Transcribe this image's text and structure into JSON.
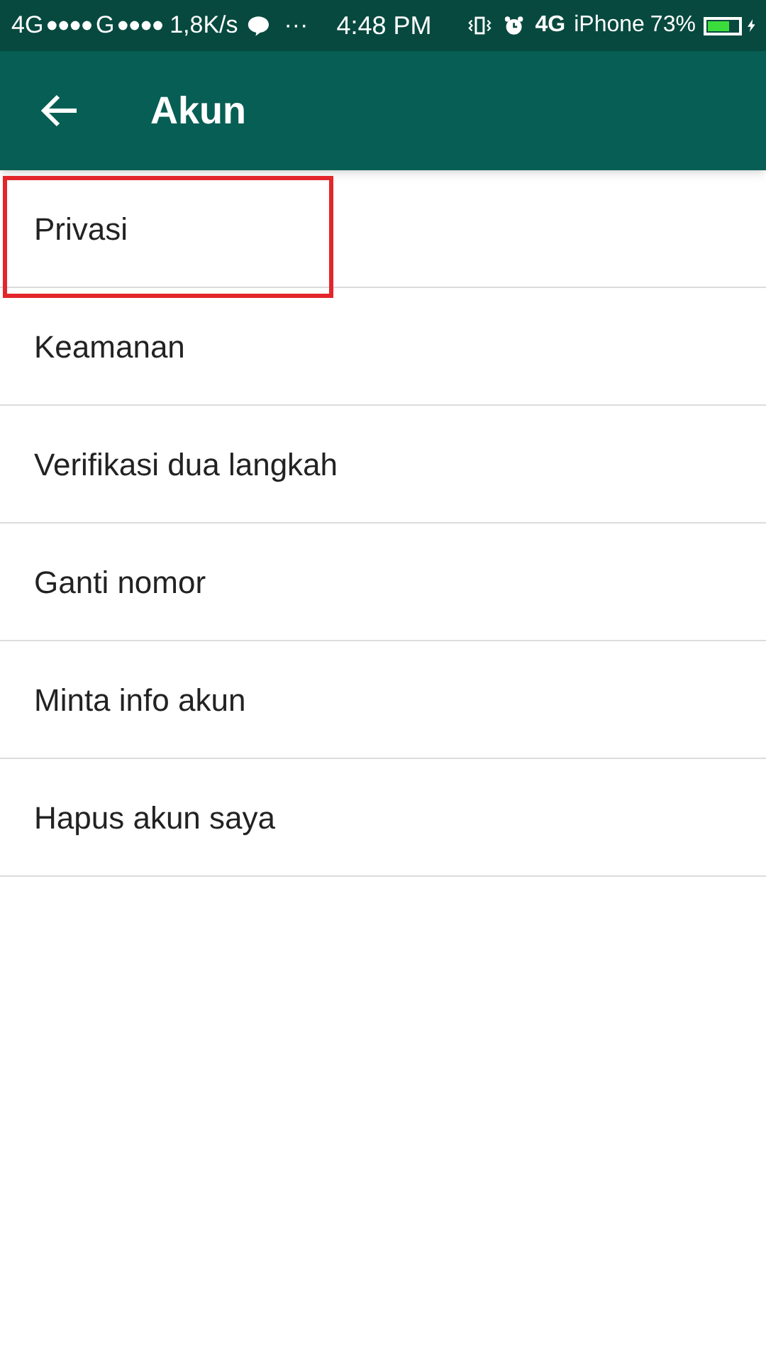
{
  "status_bar": {
    "left": [
      "4G",
      "G",
      "1,8K/s"
    ],
    "overflow": "···",
    "time": "4:48 PM",
    "network": "4G",
    "carrier": "iPhone",
    "battery": "73%"
  },
  "header": {
    "title": "Akun"
  },
  "items": [
    {
      "label": "Privasi",
      "highlighted": true
    },
    {
      "label": "Keamanan",
      "highlighted": false
    },
    {
      "label": "Verifikasi dua langkah",
      "highlighted": false
    },
    {
      "label": "Ganti nomor",
      "highlighted": false
    },
    {
      "label": "Minta info akun",
      "highlighted": false
    },
    {
      "label": "Hapus akun saya",
      "highlighted": false
    }
  ]
}
